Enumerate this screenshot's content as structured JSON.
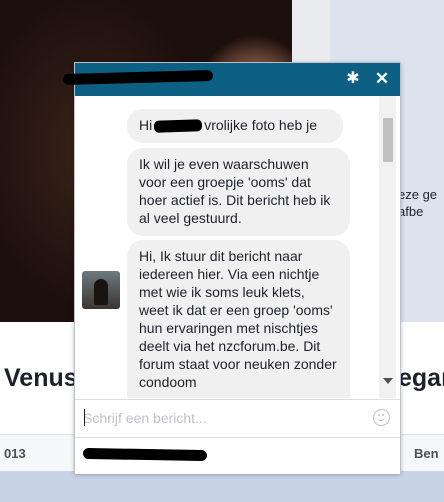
{
  "background": {
    "side_text_lines": [
      "eze ge",
      "afbe"
    ],
    "name_left": "Venus",
    "name_right": "egar",
    "tab_left": "013",
    "tab_right": "Ben"
  },
  "chat": {
    "header": {
      "title_redacted": true,
      "settings_icon": "gear-icon",
      "close_icon": "close-icon",
      "close_glyph": "✕",
      "gear_glyph": "✱"
    },
    "messages": [
      {
        "before_redaction": "Hi",
        "after_redaction": "vrolijke foto heb je"
      },
      {
        "text": "Ik wil je even waarschuwen voor een groepje 'ooms' dat hoer actief is. Dit bericht heb ik al veel gestuurd."
      },
      {
        "text": "Hi, Ik stuur dit bericht naar iedereen hier. Via een nichtje met wie ik soms leuk klets, weet ik dat er een groep 'ooms' hun ervaringen met nischtjes deelt via het nzcforum.be. Dit forum staat voor neuken zonder condoom"
      }
    ],
    "composer": {
      "placeholder": "Schrijf een bericht...",
      "value": ""
    },
    "colors": {
      "header": "#0d5f83",
      "bubble": "#f1f0f0"
    }
  }
}
